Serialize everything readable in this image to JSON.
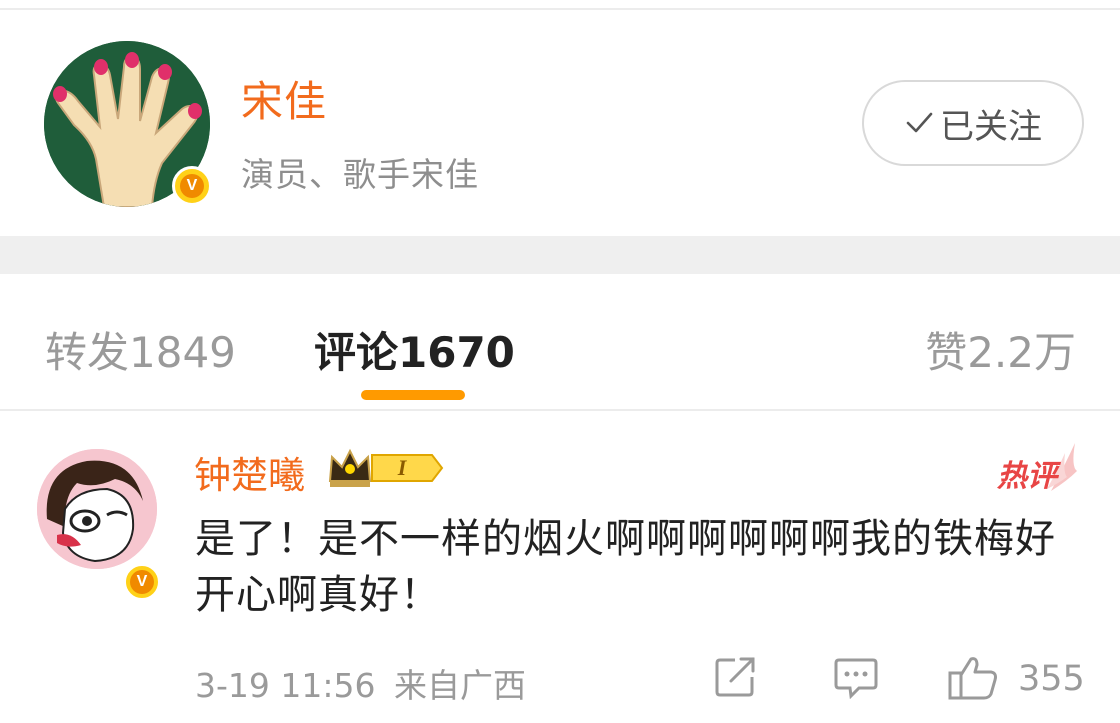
{
  "profile": {
    "name": "宋佳",
    "bio": "演员、歌手宋佳",
    "follow_label": "已关注",
    "verified_mark": "V"
  },
  "tabs": {
    "repost_label": "转发",
    "repost_count": "1849",
    "comments_label": "评论",
    "comments_count": "1670",
    "likes_label": "赞",
    "likes_count": "2.2万"
  },
  "comment": {
    "author": "钟楚曦",
    "level_badge": "I",
    "hot_tag": "热评",
    "text": "是了！是不一样的烟火啊啊啊啊啊啊我的铁梅好开心啊真好！",
    "time": "3-19 11:56",
    "source": "来自广西",
    "like_count": "355",
    "verified_mark": "V"
  },
  "colors": {
    "accent_orange": "#f26b1d",
    "tab_indicator": "#ff9a00",
    "hot_red": "#e84545",
    "muted_gray": "#9a9a9a"
  }
}
